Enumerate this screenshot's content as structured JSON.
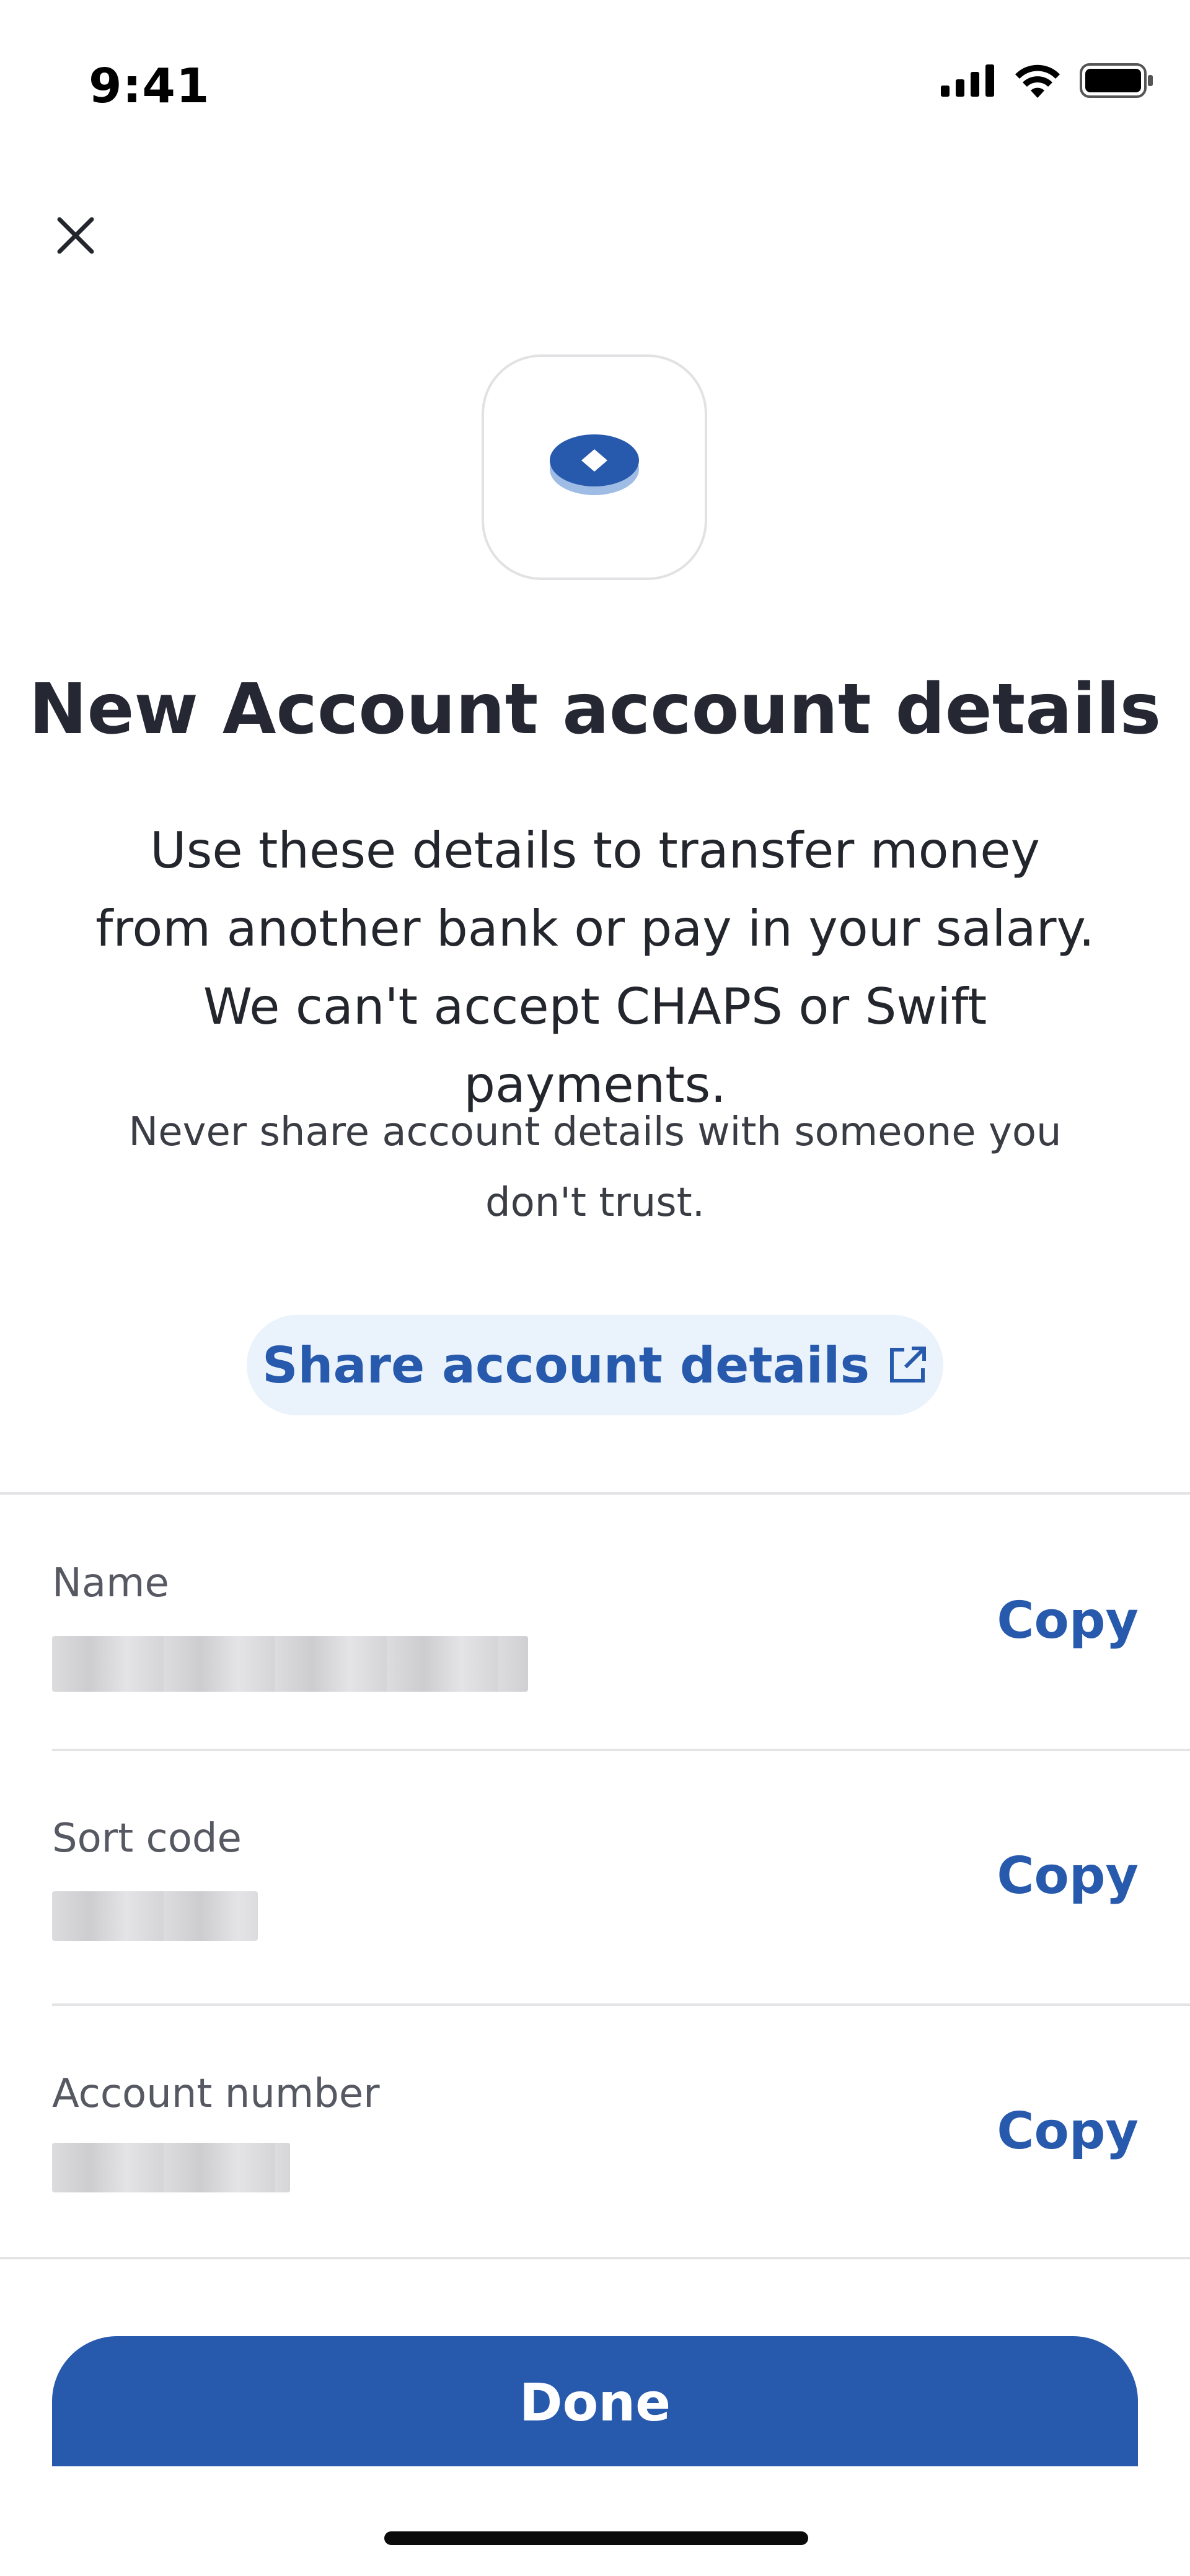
{
  "status_bar": {
    "time": "9:41"
  },
  "header": {
    "close_icon": "close-icon"
  },
  "hero": {
    "icon": "coin-stack-icon",
    "title": "New Account account details",
    "description": "Use these details to transfer money from another bank or pay in your salary. We can't accept CHAPS or Swift payments.",
    "warning": "Never share account details with someone you don't trust."
  },
  "share": {
    "label": "Share account details",
    "icon": "external-link-icon"
  },
  "details": [
    {
      "label": "Name",
      "copy_label": "Copy"
    },
    {
      "label": "Sort code",
      "copy_label": "Copy"
    },
    {
      "label": "Account number",
      "copy_label": "Copy"
    }
  ],
  "footer": {
    "done_label": "Done"
  },
  "colors": {
    "brand": "#2759ad",
    "share_bg": "#eaf2fb",
    "divider": "#e4e4e7"
  }
}
